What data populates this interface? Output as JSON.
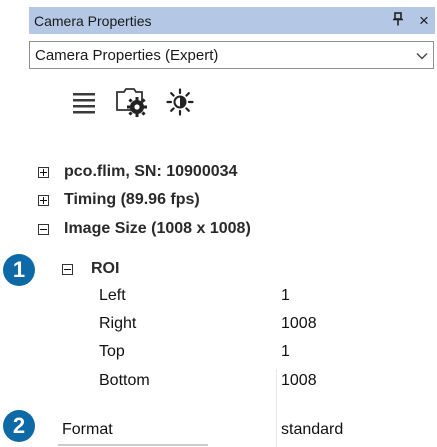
{
  "panel": {
    "title": "Camera Properties",
    "pin_icon": "pin-icon",
    "close_glyph": "×"
  },
  "mode_select": {
    "value": "Camera Properties (Expert)"
  },
  "toolbar": {
    "buttons": [
      {
        "icon": "list-icon"
      },
      {
        "icon": "camera-settings-icon"
      },
      {
        "icon": "auto-exposure-icon"
      }
    ]
  },
  "tree": {
    "camera": "pco.flim, SN: 10900034",
    "timing": "Timing (89.96 fps)",
    "image_size": "Image Size (1008 x 1008)",
    "roi": {
      "label": "ROI",
      "left": {
        "name": "Left",
        "value": "1"
      },
      "right": {
        "name": "Right",
        "value": "1008"
      },
      "top": {
        "name": "Top",
        "value": "1"
      },
      "bottom": {
        "name": "Bottom",
        "value": "1008"
      }
    },
    "format": {
      "name": "Format",
      "value": "standard"
    }
  },
  "callouts": [
    "1",
    "2"
  ],
  "colors": {
    "titlebar": "#b4c8e6",
    "badge": "#0d6aa6"
  }
}
